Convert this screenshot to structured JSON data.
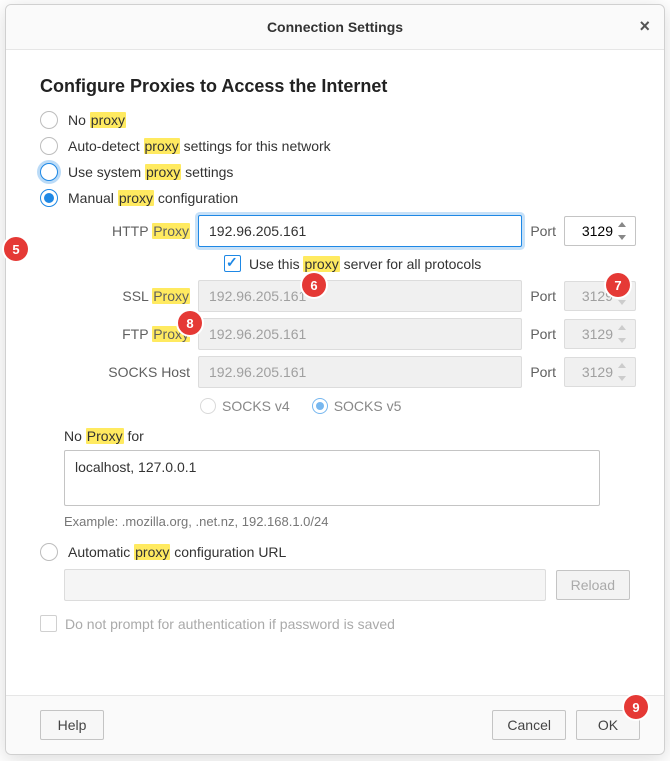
{
  "dialog": {
    "title": "Connection Settings",
    "heading": "Configure Proxies to Access the Internet"
  },
  "radios": {
    "no_proxy_pre": "No ",
    "no_proxy_hl": "proxy",
    "autodetect_pre": "Auto-detect ",
    "autodetect_hl": "proxy",
    "autodetect_post": " settings for this network",
    "system_pre": "Use system ",
    "system_hl": "proxy",
    "system_post": " settings",
    "manual_pre": "Manual ",
    "manual_hl": "proxy",
    "manual_post": " configuration",
    "auto_pre": "Automatic ",
    "auto_hl": "proxy",
    "auto_post": " configuration URL"
  },
  "labels": {
    "http_pre": "HTTP ",
    "http_hl": "Proxy",
    "ssl_pre": "SSL ",
    "ssl_hl": "Proxy",
    "ftp_pre": "FTP ",
    "ftp_hl": "Proxy",
    "socks": "SOCKS Host",
    "port": "Port",
    "socks_v4": "SOCKS v4",
    "socks_v5": "SOCKS v5",
    "no_proxy_for_pre": "No ",
    "no_proxy_for_hl": "Proxy",
    "no_proxy_for_post": " for"
  },
  "values": {
    "http_proxy": "192.96.205.161",
    "http_port": "3129",
    "ssl_proxy": "192.96.205.161",
    "ssl_port": "3129",
    "ftp_proxy": "192.96.205.161",
    "ftp_port": "3129",
    "socks_proxy": "192.96.205.161",
    "socks_port": "3129",
    "no_proxy_list": "localhost, 127.0.0.1"
  },
  "checkbox": {
    "use_all_pre": "Use this ",
    "use_all_hl": "proxy",
    "use_all_post": " server for all protocols"
  },
  "example": "Example: .mozilla.org, .net.nz, 192.168.1.0/24",
  "noprompt": "Do not prompt for authentication if password is saved",
  "buttons": {
    "reload": "Reload",
    "help": "Help",
    "cancel": "Cancel",
    "ok": "OK"
  },
  "markers": {
    "m5": "5",
    "m6": "6",
    "m7": "7",
    "m8": "8",
    "m9": "9"
  }
}
